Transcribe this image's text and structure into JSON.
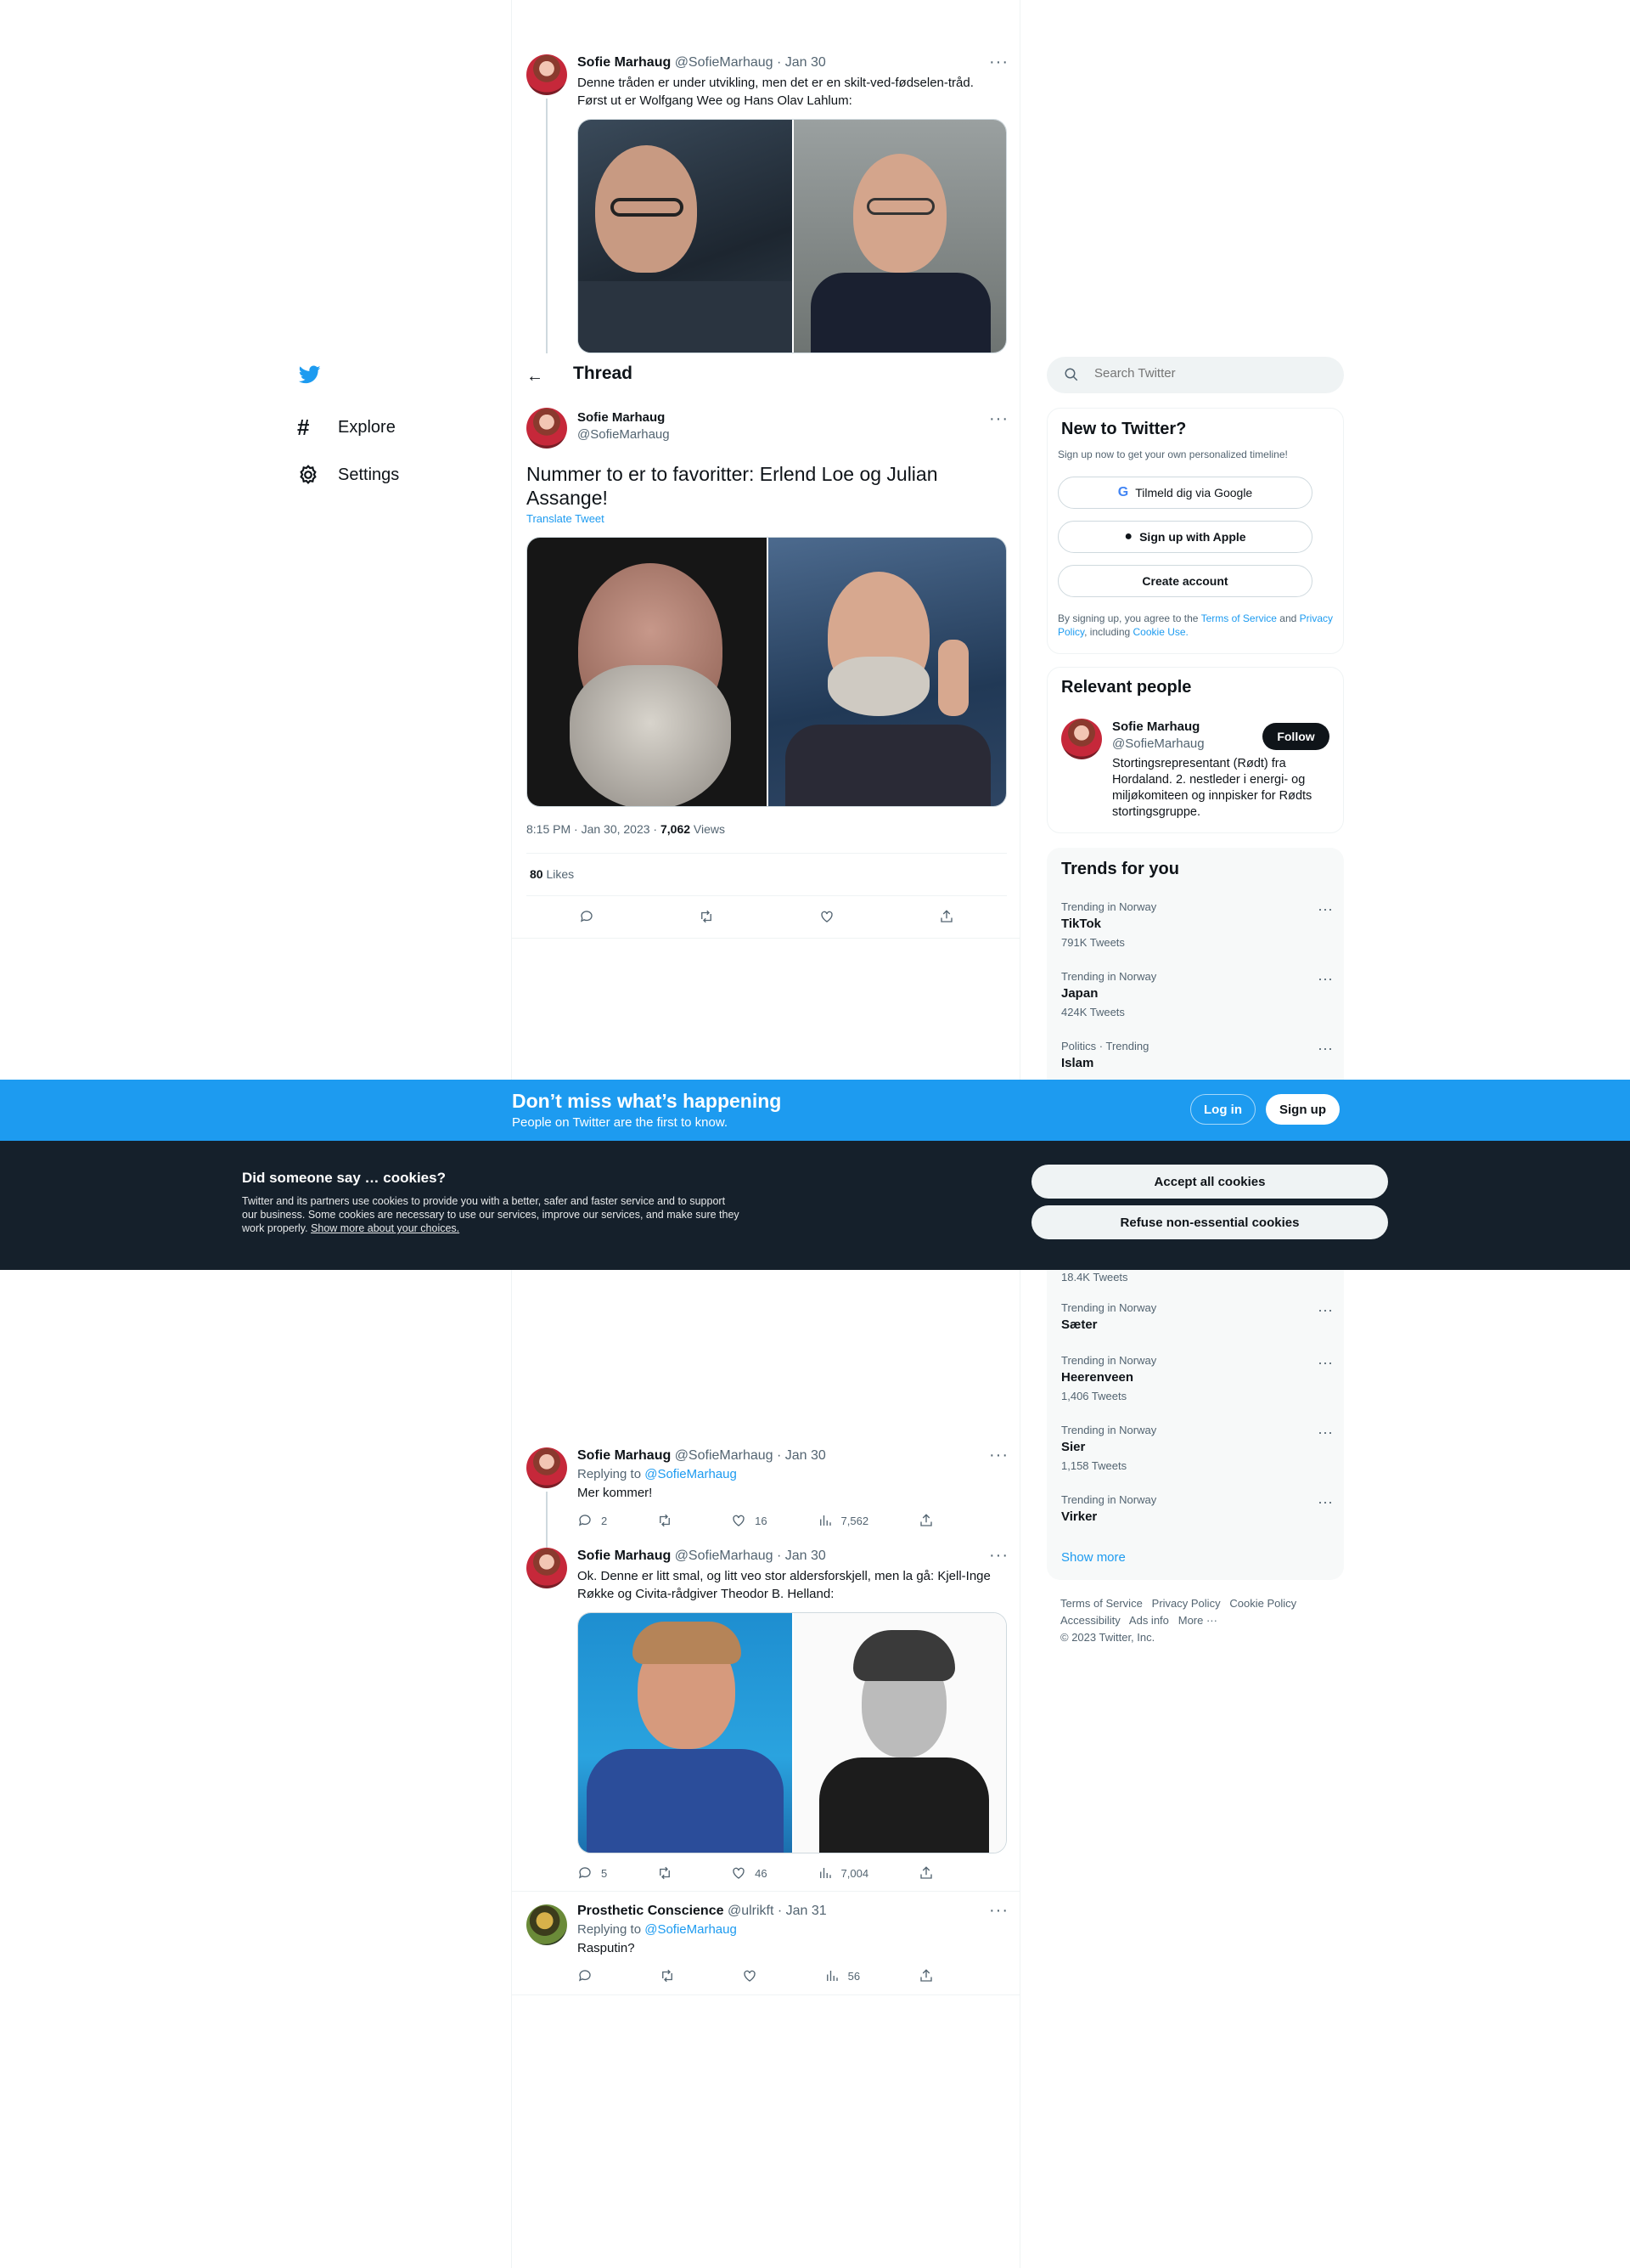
{
  "nav": {
    "explore_label": "Explore",
    "settings_label": "Settings"
  },
  "header": {
    "title": "Thread"
  },
  "first_tweet": {
    "name": "Sofie Marhaug",
    "handle": "@SofieMarhaug",
    "date": "· Jan 30",
    "text_line1": "Denne tråden er under utvikling, men det er en skilt-ved-fødselen-tråd.",
    "text_line2": "Først ut er Wolfgang Wee og Hans Olav Lahlum:"
  },
  "main_tweet": {
    "name": "Sofie Marhaug",
    "handle": "@SofieMarhaug",
    "text": "Nummer to er to favoritter: Erlend Loe og Julian Assange!",
    "translate_label": "Translate Tweet",
    "time": "8:15 PM · Jan 30, 2023 ·",
    "views_count": "7,062",
    "views_label": "Views",
    "likes_count": "80",
    "likes_label": "Likes"
  },
  "replies": [
    {
      "name": "Sofie Marhaug",
      "handle": "@SofieMarhaug",
      "date": "· Jan 30",
      "replying_label": "Replying to",
      "replying_to": "@SofieMarhaug",
      "text": "Mer kommer!",
      "replies": "2",
      "retweets": "",
      "likes": "16",
      "views": "7,562"
    },
    {
      "name": "Sofie Marhaug",
      "handle": "@SofieMarhaug",
      "date": "· Jan 30",
      "text_line1": "Ok. Denne er litt smal, og litt veo stor aldersforskjell, men la gå: Kjell-Inge",
      "text_line2": "Røkke og Civita-rådgiver Theodor B. Helland:",
      "replies": "5",
      "retweets": "",
      "likes": "46",
      "views": "7,004"
    },
    {
      "name": "Prosthetic Conscience",
      "handle": "@ulrikft",
      "date": "· Jan 31",
      "replying_label": "Replying to",
      "replying_to": "@SofieMarhaug",
      "text": "Rasputin?",
      "replies": "",
      "retweets": "",
      "likes": "",
      "views": "56"
    }
  ],
  "search": {
    "placeholder": "Search Twitter"
  },
  "signup_card": {
    "title": "New to Twitter?",
    "subtitle": "Sign up now to get your own personalized timeline!",
    "google_label": "Tilmeld dig via Google",
    "apple_label": "Sign up with Apple",
    "create_label": "Create account",
    "legal_prefix": "By signing up, you agree to the",
    "terms": "Terms of Service",
    "and": "and",
    "privacy": "Privacy Policy",
    "including": ", including",
    "cookie_use": "Cookie Use."
  },
  "relevant": {
    "title": "Relevant people",
    "name": "Sofie Marhaug",
    "handle": "@SofieMarhaug",
    "follow_label": "Follow",
    "bio_line1": "Stortingsrepresentant (Rødt) fra",
    "bio_line2": "Hordaland. 2. nestleder i energi- og",
    "bio_line3": "miljøkomiteen og innpisker for Rødts",
    "bio_line4": "stortingsgruppe."
  },
  "trends": {
    "title": "Trends for you",
    "items": [
      {
        "category": "Trending in Norway",
        "name": "TikTok",
        "count": "791K Tweets"
      },
      {
        "category": "Trending in Norway",
        "name": "Japan",
        "count": "424K Tweets"
      },
      {
        "category": "Politics · Trending",
        "name": "Islam",
        "count": ""
      },
      {
        "category": "",
        "name": "",
        "count": "18.4K Tweets"
      },
      {
        "category": "Trending in Norway",
        "name": "Sæter",
        "count": ""
      },
      {
        "category": "Trending in Norway",
        "name": "Heerenveen",
        "count": "1,406 Tweets"
      },
      {
        "category": "Trending in Norway",
        "name": "Sier",
        "count": "1,158 Tweets"
      },
      {
        "category": "Trending in Norway",
        "name": "Virker",
        "count": ""
      }
    ],
    "show_more": "Show more"
  },
  "footer": {
    "terms": "Terms of Service",
    "privacy": "Privacy Policy",
    "cookie": "Cookie Policy",
    "accessibility": "Accessibility",
    "ads": "Ads info",
    "more": "More ···",
    "copyright": "© 2023 Twitter, Inc."
  },
  "banner": {
    "title": "Don’t miss what’s happening",
    "subtitle": "People on Twitter are the first to know.",
    "login_label": "Log in",
    "signup_label": "Sign up"
  },
  "cookies": {
    "title": "Did someone say … cookies?",
    "body_line1": "Twitter and its partners use cookies to provide you with a better, safer and faster service and to support",
    "body_line2": "our business. Some cookies are necessary to use our services, improve our services, and make sure they",
    "body_line3": "work properly.",
    "body_link": "Show more about your choices.",
    "accept_label": "Accept all cookies",
    "refuse_label": "Refuse non-essential cookies"
  },
  "colors": {
    "accent": "#1d9bf0",
    "cookie_bg": "#15202b",
    "text": "#0f1419",
    "muted": "#536471"
  }
}
